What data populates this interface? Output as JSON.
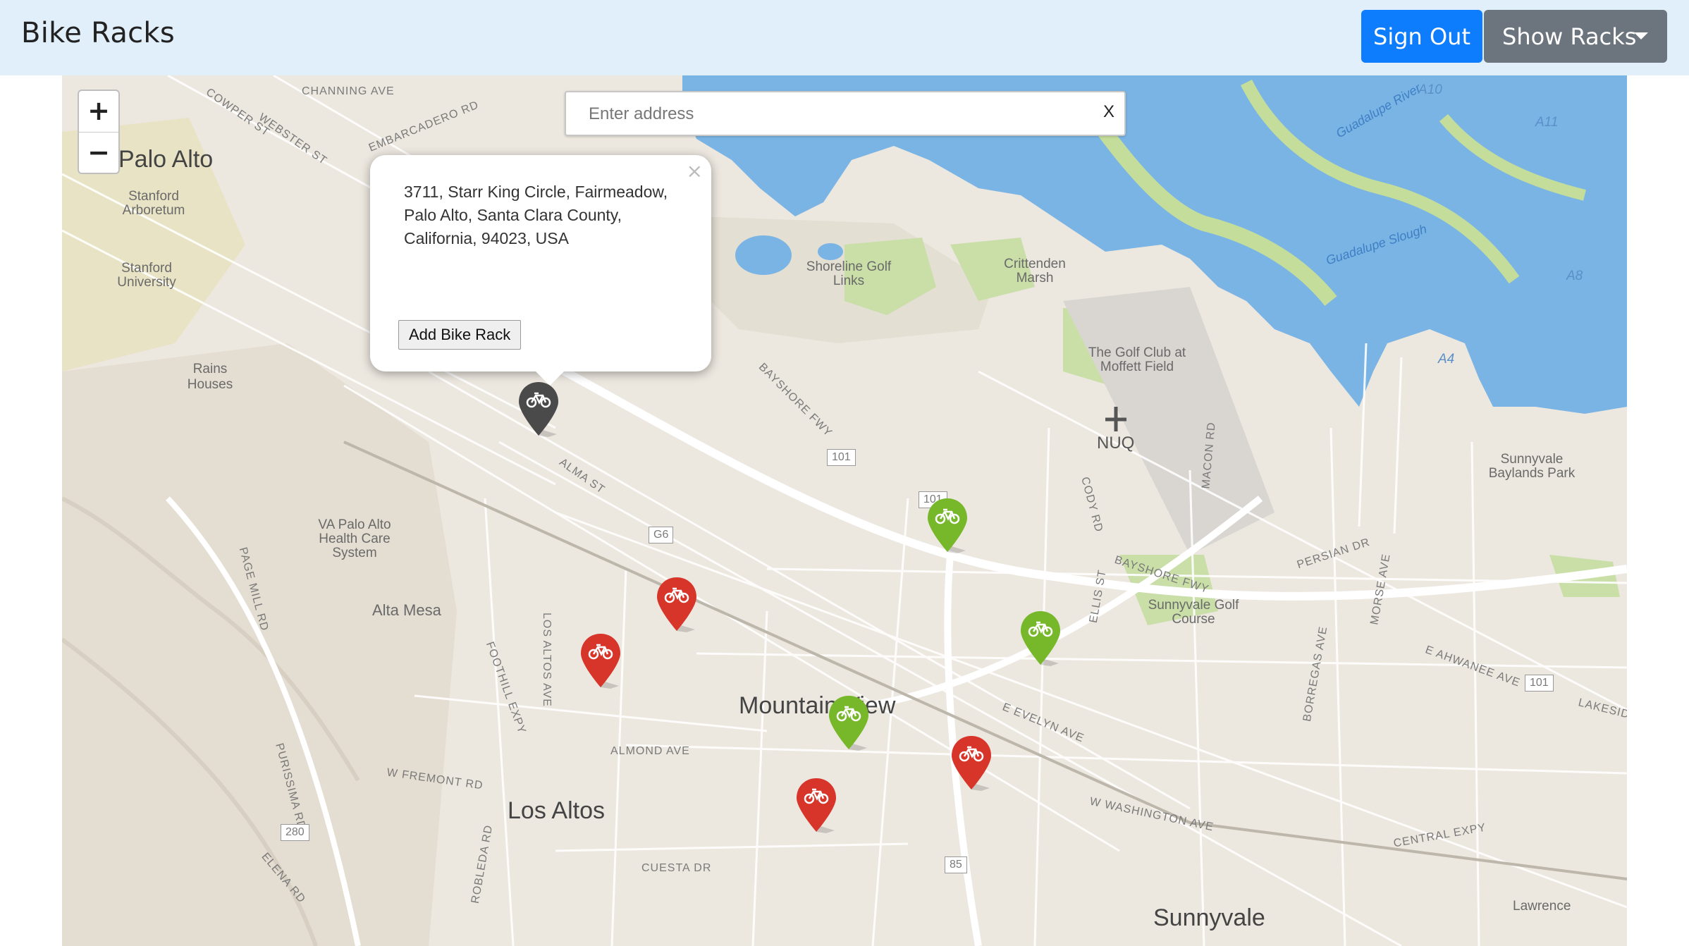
{
  "navbar": {
    "brand": "Bike Racks",
    "sign_out_label": "Sign Out",
    "show_racks_label": "Show Racks"
  },
  "search": {
    "placeholder": "Enter address",
    "value": "",
    "clear_label": "X"
  },
  "zoom": {
    "in_label": "+",
    "out_label": "−"
  },
  "popup": {
    "close_label": "×",
    "address": "3711, Starr King Circle, Fairmeadow, Palo Alto, Santa Clara County, California, 94023, USA",
    "add_button_label": "Add Bike Rack"
  },
  "colors": {
    "navbar_bg": "#e1effa",
    "sign_out_bg": "#0d7dfd",
    "show_racks_bg": "#6c757d",
    "marker_green": "#76b82a",
    "marker_red": "#d8352a",
    "marker_gray": "#4a4a4a",
    "water": "#79b4e4",
    "land": "#ece7df"
  },
  "markers": [
    {
      "status": "selected",
      "color": "gray",
      "icon": "bicycle-icon"
    },
    {
      "status": "available",
      "color": "green",
      "icon": "bicycle-icon"
    },
    {
      "status": "available",
      "color": "green",
      "icon": "bicycle-icon"
    },
    {
      "status": "available",
      "color": "green",
      "icon": "bicycle-icon"
    },
    {
      "status": "unavailable",
      "color": "red",
      "icon": "bicycle-icon"
    },
    {
      "status": "unavailable",
      "color": "red",
      "icon": "bicycle-icon"
    },
    {
      "status": "unavailable",
      "color": "red",
      "icon": "bicycle-icon"
    },
    {
      "status": "unavailable",
      "color": "red",
      "icon": "bicycle-icon"
    }
  ],
  "map_labels": {
    "palo_alto": "Palo Alto",
    "stanford_arboretum": "Stanford Arboretum",
    "stanford_university": "Stanford University",
    "rains_houses": "Rains Houses",
    "va_palo_alto": "VA Palo Alto Health Care System",
    "alta_mesa": "Alta Mesa",
    "mountain_view": "Mountain View",
    "los_altos": "Los Altos",
    "sunnyvale": "Sunnyvale",
    "shoreline_golf": "Shoreline Golf Links",
    "crittenden_marsh": "Crittenden Marsh",
    "golf_club_moffett": "The Golf Club at Moffett Field",
    "nuq": "NUQ",
    "sunnyvale_baylands": "Sunnyvale Baylands Park",
    "sunnyvale_golf": "Sunnyvale Golf Course",
    "lawrence": "Lawrence",
    "channing_ave": "CHANNING AVE",
    "cowper_st": "COWPER ST",
    "webster_st": "WEBSTER ST",
    "embarcadero_rd": "EMBARCADERO RD",
    "bayshore_fwy": "BAYSHORE FWY",
    "alma_st": "ALMA ST",
    "almond_ave": "ALMOND AVE",
    "w_fremont_rd": "W FREMONT RD",
    "cuesta_dr": "CUESTA DR",
    "e_evelyn_ave": "E EVELYN AVE",
    "w_washington_ave": "W WASHINGTON AVE",
    "central_expy": "CENTRAL EXPY",
    "persian_dr": "PERSIAN DR",
    "e_ahwanee_ave": "E AHWANEE AVE",
    "guadalupe_river": "Guadalupe River",
    "guadalupe_slough": "Guadalupe Slough",
    "foothill_expy": "FOOTHILL EXPY",
    "los_altos_ave": "LOS ALTOS AVE",
    "page_mill_rd": "PAGE MILL RD",
    "purissima_rd": "PURISSIMA RD",
    "elena_rd": "ELENA RD",
    "robleda_rd": "ROBLEDA RD",
    "cody_rd": "CODY RD",
    "ellis_st": "ELLIS ST",
    "macon_rd": "MACON RD",
    "borregas_ave": "BORREGAS AVE",
    "morse_ave": "MORSE AVE",
    "lakeside": "LAKESID",
    "a10": "A10",
    "a11": "A11",
    "a8": "A8",
    "a4": "A4",
    "hwy_101_a": "101",
    "hwy_101_b": "101",
    "hwy_101_c": "101",
    "hwy_g6": "G6",
    "hwy_85": "85",
    "hwy_280": "280"
  }
}
